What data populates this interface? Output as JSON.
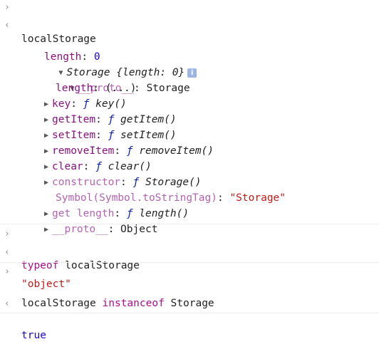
{
  "gutter": {
    "input": "›",
    "output": "‹"
  },
  "entries": {
    "cmd1": "localStorage",
    "storage_name": "Storage",
    "storage_summary": "{length: 0}",
    "info_badge": "i",
    "length_key": "length",
    "length_value": "0",
    "proto_key": "__proto__",
    "proto_value": "Storage",
    "proto_length_key": "length",
    "proto_length_value": "(...)",
    "methods": [
      {
        "key": "key",
        "fn": "key()"
      },
      {
        "key": "getItem",
        "fn": "getItem()"
      },
      {
        "key": "setItem",
        "fn": "setItem()"
      },
      {
        "key": "removeItem",
        "fn": "removeItem()"
      },
      {
        "key": "clear",
        "fn": "clear()"
      },
      {
        "key": "constructor",
        "fn": "Storage()"
      }
    ],
    "f_glyph": "ƒ",
    "tostringtag_key": "Symbol(Symbol.toStringTag)",
    "tostringtag_value": "\"Storage\"",
    "get_length_key": "get length",
    "get_length_fn": "length()",
    "proto2_key": "__proto__",
    "proto2_value": "Object",
    "cmd2_keyword": "typeof",
    "cmd2_rest": "localStorage",
    "result2": "\"object\"",
    "cmd3_a": "localStorage",
    "cmd3_keyword": "instanceof",
    "cmd3_b": "Storage",
    "result3": "true"
  },
  "colors": {
    "key": "#881280",
    "number": "#1c00cf",
    "string": "#c41a16",
    "keyword": "#aa0d91",
    "function": "#0d22aa"
  }
}
